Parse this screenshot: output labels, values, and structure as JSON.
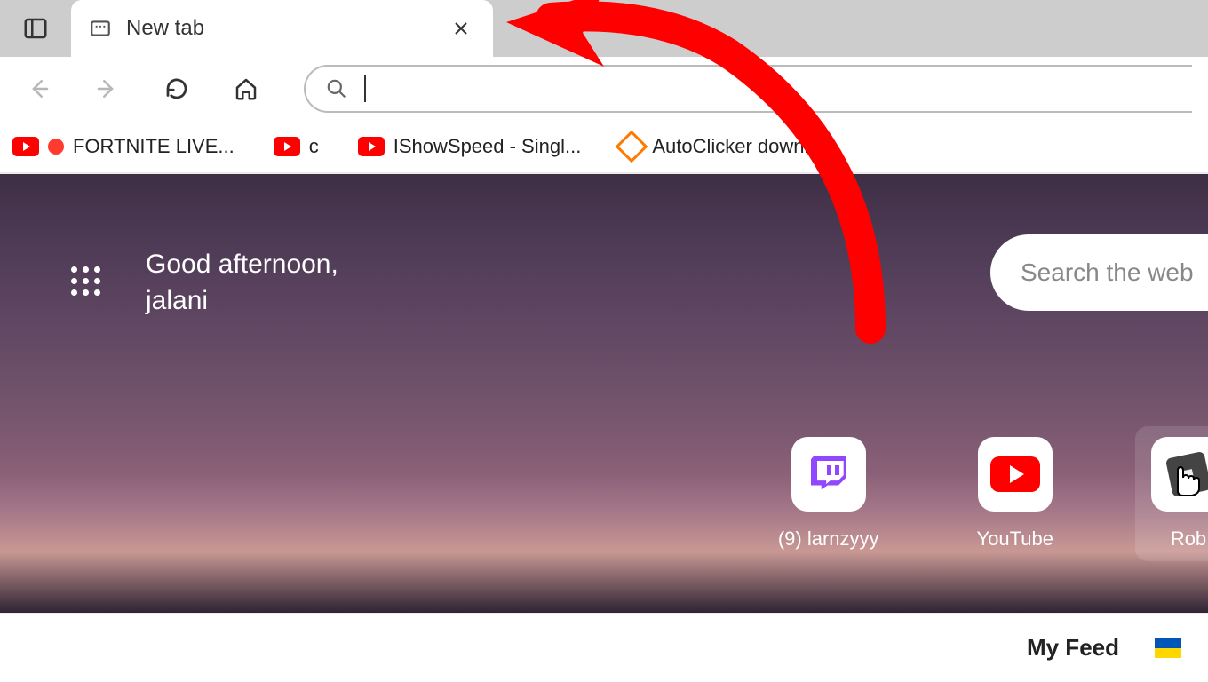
{
  "tab": {
    "title": "New tab"
  },
  "address": {
    "placeholder": ""
  },
  "bookmarks": [
    {
      "label": "FORTNITE LIVE...",
      "icon": "youtube",
      "live": true
    },
    {
      "label": "c",
      "icon": "youtube",
      "live": false
    },
    {
      "label": "IShowSpeed - Singl...",
      "icon": "youtube",
      "live": false
    },
    {
      "label": "AutoClicker downlo...",
      "icon": "autoclicker",
      "live": false
    }
  ],
  "greeting": {
    "line1": "Good afternoon,",
    "line2": "jalani"
  },
  "search_web": {
    "placeholder": "Search the web"
  },
  "quick_links": [
    {
      "label": "(9) larnzyyy",
      "kind": "twitch"
    },
    {
      "label": "YouTube",
      "kind": "youtube"
    },
    {
      "label": "Rob",
      "kind": "roblox"
    }
  ],
  "feed": {
    "label": "My Feed"
  }
}
